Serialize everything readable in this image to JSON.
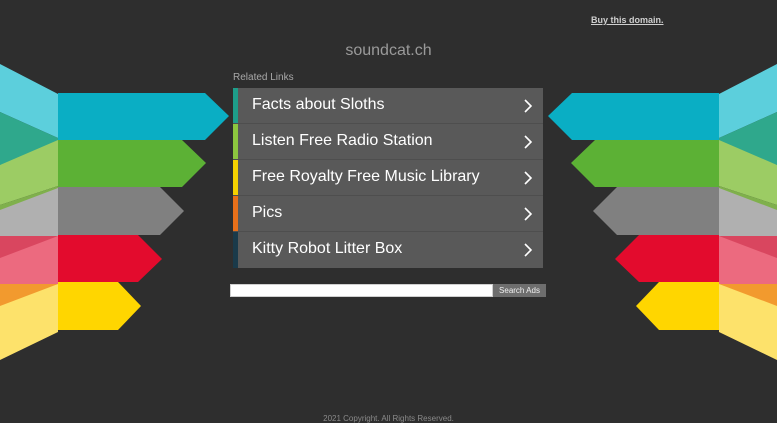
{
  "header": {
    "buy_link": "Buy this domain.",
    "domain": "soundcat.ch"
  },
  "related": {
    "label": "Related Links",
    "items": [
      {
        "label": "Facts about Sloths",
        "color": "#1e9e8a"
      },
      {
        "label": "Listen Free Radio Station",
        "color": "#8cc63f"
      },
      {
        "label": "Free Royalty Free Music Library",
        "color": "#f5d100"
      },
      {
        "label": "Pics",
        "color": "#e8701a"
      },
      {
        "label": "Kitty Robot Litter Box",
        "color": "#1a3a4a"
      }
    ]
  },
  "search": {
    "button_label": "Search Ads",
    "value": ""
  },
  "footer": {
    "copyright": "2021 Copyright. All Rights Reserved."
  },
  "colors": {
    "background": "#2e2e2e",
    "teal": "#0aaec4",
    "green": "#5cb135",
    "gray": "#808080",
    "red": "#e30b2d",
    "yellow": "#ffd600"
  }
}
